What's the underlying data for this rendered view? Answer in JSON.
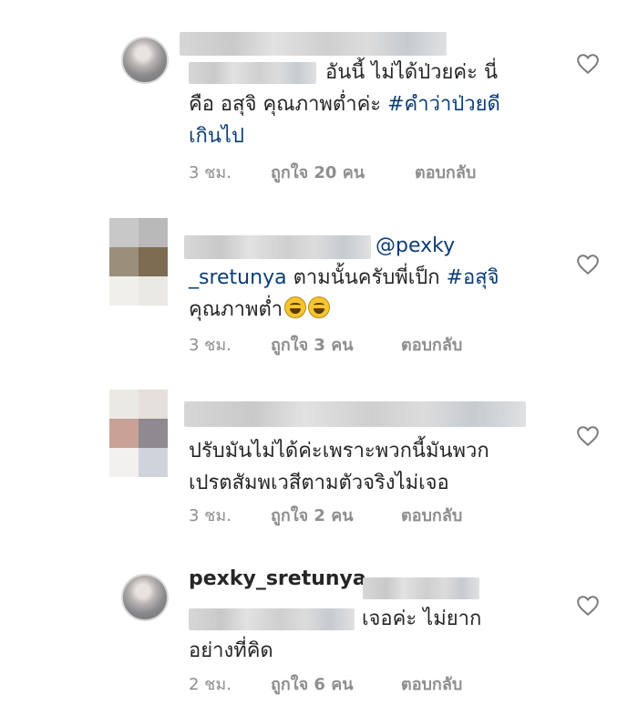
{
  "comments": [
    {
      "text_line1": "อันนี้ ไม่ได้ป่วยค่ะ นี่",
      "text_line2": "คือ อสุจิ คุณภาพต่ำค่ะ ",
      "hashtag_line2": "#คำว่าป่วยดี",
      "hashtag_line3": "เกินไป",
      "time": "3 ชม.",
      "likes": "ถูกใจ 20 คน",
      "reply": "ตอบกลับ"
    },
    {
      "mention": "@pexky",
      "mention_line2": "_sretunya",
      "text_line2": " ตามนั้นครับพี่เป็ก ",
      "hashtag_line2": "#อสุจิ",
      "text_line3": "คุณภาพต่ำ",
      "time": "3 ชม.",
      "likes": "ถูกใจ 3 คน",
      "reply": "ตอบกลับ"
    },
    {
      "text_line1": "ปรับมันไม่ได้ค่ะเพราะพวกนี้มันพวก",
      "text_line2": "เปรตสัมพเวสีตามตัวจริงไม่เจอ",
      "time": "3 ชม.",
      "likes": "ถูกใจ 2 คน",
      "reply": "ตอบกลับ"
    },
    {
      "username": "pexky_sretunya",
      "text_line1": "เจอค่ะ ไม่ยาก",
      "text_line2": "อย่างที่คิด",
      "time": "2 ชม.",
      "likes": "ถูกใจ 6 คน",
      "reply": "ตอบกลับ"
    }
  ],
  "colors": {
    "hashtag": "#0b3d76",
    "meta": "#8e8e8e",
    "text": "#262626"
  },
  "icons": {
    "like": "heart-outline-icon"
  }
}
